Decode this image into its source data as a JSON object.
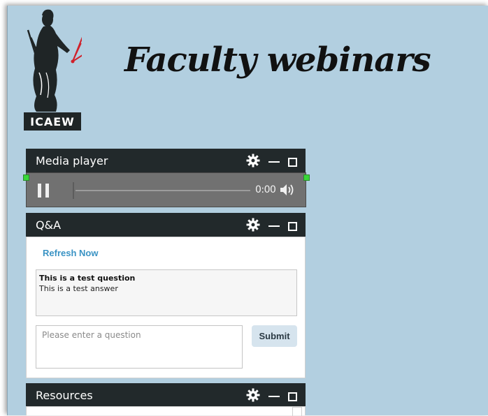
{
  "page": {
    "title": "Faculty webinars"
  },
  "brand": {
    "logo_text": "ICAEW"
  },
  "media_player": {
    "title": "Media player",
    "time": "0:00",
    "progress": 0
  },
  "qa": {
    "title": "Q&A",
    "refresh_label": "Refresh Now",
    "entries": [
      {
        "question": "This is a test question",
        "answer": "This is a test answer"
      }
    ],
    "input_placeholder": "Please enter a question",
    "submit_label": "Submit"
  },
  "resources": {
    "title": "Resources"
  },
  "colors": {
    "background": "#b2cfe0",
    "panel_header": "#22292b",
    "player_bg": "#717171",
    "link": "#3a93c4",
    "handle": "#39d739",
    "logo_accent": "#d0202a"
  },
  "icons": {
    "settings": "gear-icon",
    "minimize": "minimize-icon",
    "maximize": "maximize-icon",
    "pause": "pause-icon",
    "volume": "volume-icon"
  }
}
